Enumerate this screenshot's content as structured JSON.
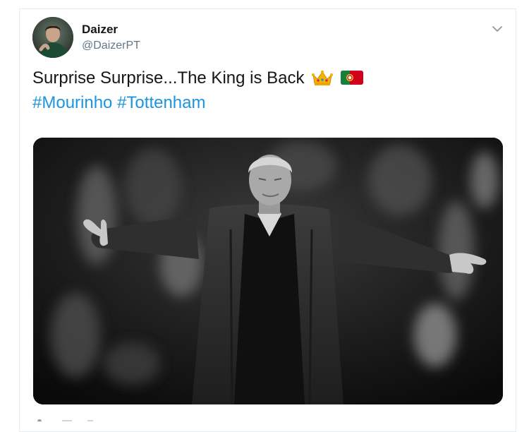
{
  "tweet": {
    "display_name": "Daizer",
    "handle": "@DaizerPT",
    "text": "Surprise Surprise...The King is Back",
    "emojis": [
      "crown-emoji",
      "portugal-flag-emoji"
    ],
    "hashtags": [
      "#Mourinho",
      "#Tottenham"
    ]
  },
  "icons": {
    "caret": "chevron-down-icon"
  },
  "colors": {
    "link": "#1b95e0",
    "text": "#14171a",
    "secondary": "#657786",
    "border": "#e6ecf0"
  }
}
